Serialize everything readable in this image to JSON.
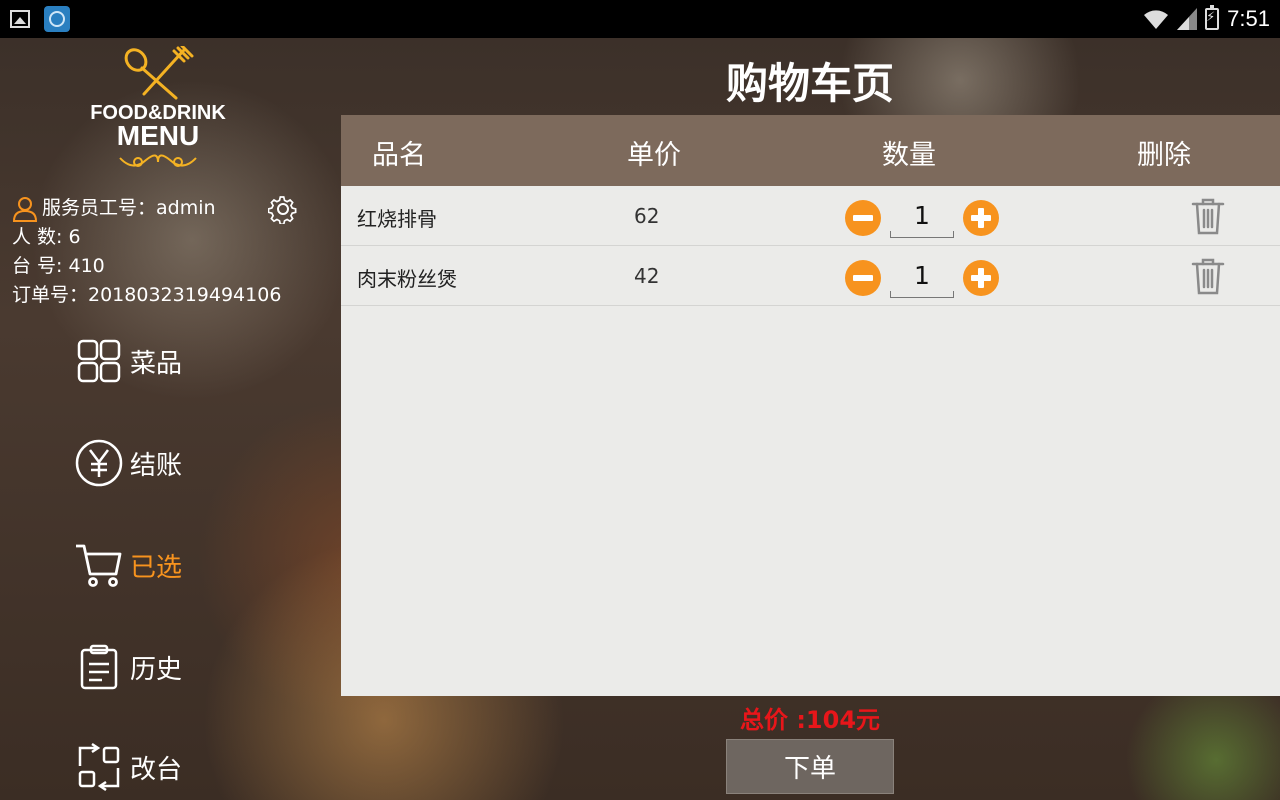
{
  "status_bar": {
    "time": "7:51"
  },
  "logo": {
    "line1": "FOOD&DRINK",
    "line2": "MENU"
  },
  "info": {
    "waiter": "服务员工号：admin",
    "people": "人 数:  6",
    "table": "台 号:  410",
    "order": "订单号：2018032319494106"
  },
  "nav": {
    "dishes": "菜品",
    "checkout": "结账",
    "selected": "已选",
    "history": "历史",
    "change_table": "改台"
  },
  "page_title": "购物车页",
  "table": {
    "headers": {
      "name": "品名",
      "price": "单价",
      "qty": "数量",
      "delete": "删除"
    },
    "rows": [
      {
        "name": "红烧排骨",
        "price": "62",
        "qty": "1"
      },
      {
        "name": "肉末粉丝煲",
        "price": "42",
        "qty": "1"
      }
    ]
  },
  "total": "总价 :104元",
  "order_button": "下单",
  "colors": {
    "accent": "#f7931e",
    "header_bg": "#7d6a5c",
    "total": "#e8161a"
  }
}
